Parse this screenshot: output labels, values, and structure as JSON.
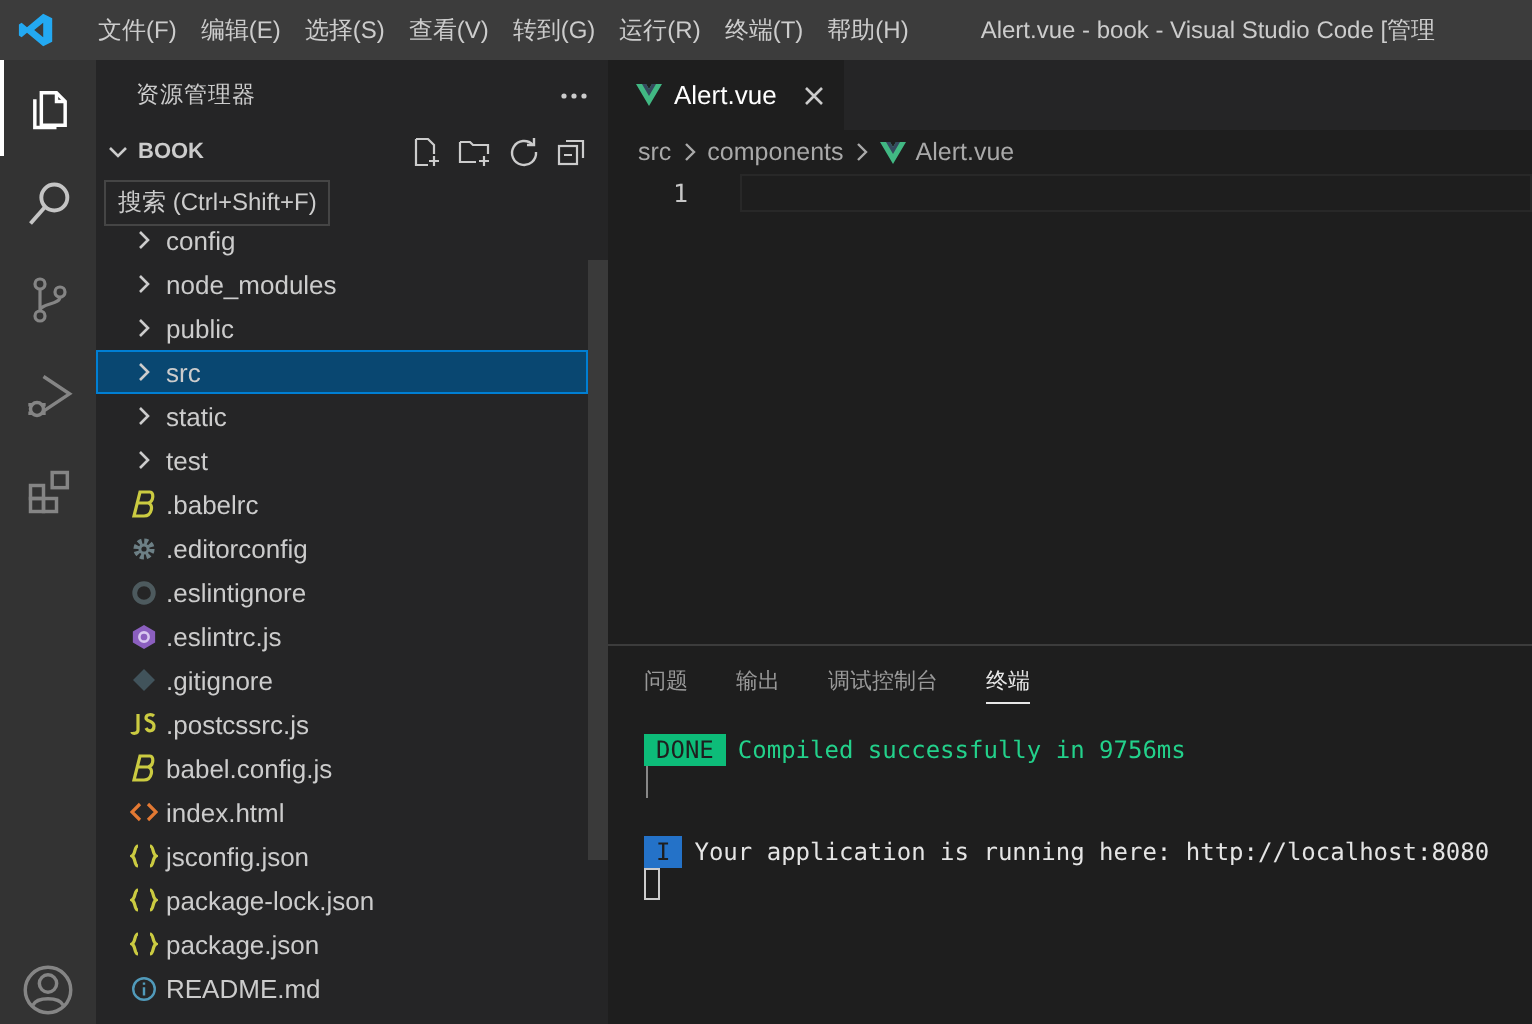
{
  "menu": [
    "文件(F)",
    "编辑(E)",
    "选择(S)",
    "查看(V)",
    "转到(G)",
    "运行(R)",
    "终端(T)",
    "帮助(H)"
  ],
  "window": {
    "title": "Alert.vue - book - Visual Studio Code [管理"
  },
  "activity_bar": [
    {
      "kind": "files",
      "selected": true
    },
    {
      "kind": "search",
      "selected": false
    },
    {
      "kind": "branch",
      "selected": false
    },
    {
      "kind": "debug",
      "selected": false
    },
    {
      "kind": "extensions",
      "selected": false
    }
  ],
  "tooltip": "搜索 (Ctrl+Shift+F)",
  "sidebar": {
    "title": "资源管理器",
    "section": {
      "label": "BOOK",
      "expanded": true
    },
    "items": [
      {
        "label": "config",
        "kind": "folder",
        "selected": false
      },
      {
        "label": "node_modules",
        "kind": "folder",
        "selected": false
      },
      {
        "label": "public",
        "kind": "folder",
        "selected": false
      },
      {
        "label": "src",
        "kind": "folder",
        "selected": true
      },
      {
        "label": "static",
        "kind": "folder",
        "selected": false
      },
      {
        "label": "test",
        "kind": "folder",
        "selected": false
      },
      {
        "label": ".babelrc",
        "kind": "babel",
        "selected": false
      },
      {
        "label": ".editorconfig",
        "kind": "gear",
        "selected": false
      },
      {
        "label": ".eslintignore",
        "kind": "ring",
        "selected": false
      },
      {
        "label": ".eslintrc.js",
        "kind": "eslint",
        "selected": false
      },
      {
        "label": ".gitignore",
        "kind": "git",
        "selected": false
      },
      {
        "label": ".postcssrc.js",
        "kind": "js",
        "selected": false
      },
      {
        "label": "babel.config.js",
        "kind": "babel",
        "selected": false
      },
      {
        "label": "index.html",
        "kind": "html",
        "selected": false
      },
      {
        "label": "jsconfig.json",
        "kind": "json",
        "selected": false
      },
      {
        "label": "package-lock.json",
        "kind": "json",
        "selected": false
      },
      {
        "label": "package.json",
        "kind": "json",
        "selected": false
      },
      {
        "label": "README.md",
        "kind": "info",
        "selected": false
      }
    ]
  },
  "editor": {
    "tabs": [
      {
        "label": "Alert.vue",
        "selected": true
      }
    ],
    "breadcrumb": [
      "src",
      "components",
      "Alert.vue"
    ],
    "line_numbers": [
      "1"
    ]
  },
  "panel": {
    "tabs": [
      {
        "label": "问题",
        "selected": false
      },
      {
        "label": "输出",
        "selected": false
      },
      {
        "label": "调试控制台",
        "selected": false
      },
      {
        "label": "终端",
        "selected": true
      }
    ],
    "lines": [
      {
        "kind": "done",
        "badge": "DONE",
        "text": "Compiled successfully in 9756ms"
      },
      {
        "kind": "info",
        "badge": "I",
        "text": "Your application is running here: http://localhost:8080"
      }
    ]
  }
}
